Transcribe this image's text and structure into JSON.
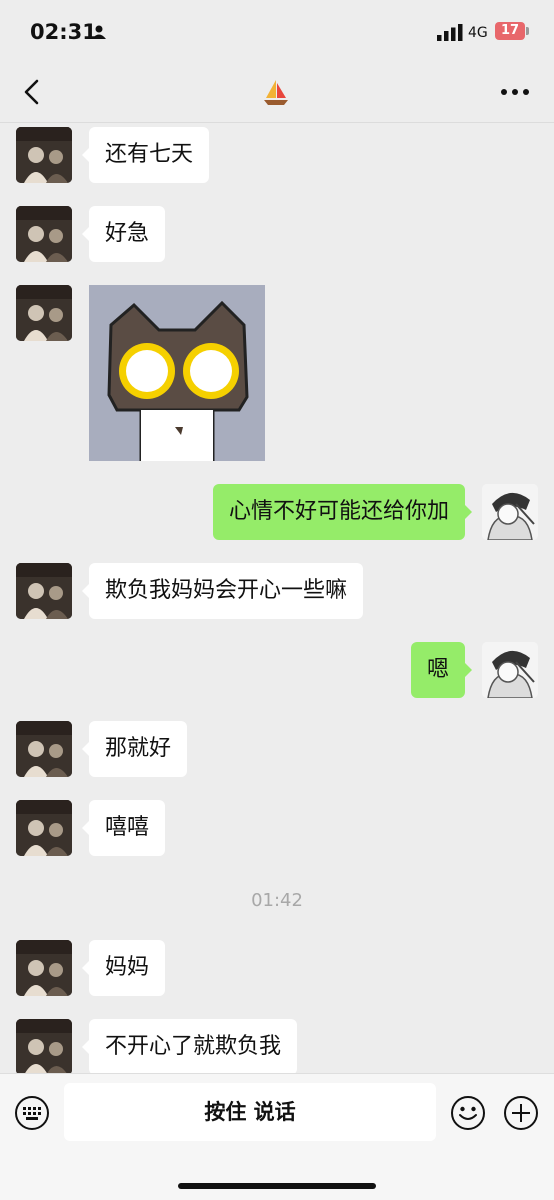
{
  "status": {
    "time": "02:31",
    "network": "4G",
    "battery": "17"
  },
  "nav": {
    "back_icon": "chevron-left-icon",
    "title_icon": "sailboat-icon",
    "more_icon": "more-dots-icon"
  },
  "messages": [
    {
      "side": "in",
      "text": "还有七天"
    },
    {
      "side": "in",
      "text": "好急"
    },
    {
      "side": "in",
      "type": "sticker",
      "sticker": "glowing-eyes-cat-sticker"
    },
    {
      "side": "out",
      "text": "心情不好可能还给你加"
    },
    {
      "side": "in",
      "text": "欺负我妈妈会开心一些嘛"
    },
    {
      "side": "out",
      "text": "嗯"
    },
    {
      "side": "in",
      "text": "那就好"
    },
    {
      "side": "in",
      "text": "嘻嘻"
    },
    {
      "type": "time",
      "text": "01:42"
    },
    {
      "side": "in",
      "text": "妈妈"
    },
    {
      "side": "in",
      "text": "不开心了就欺负我"
    }
  ],
  "input_bar": {
    "voice_label": "按住 说话",
    "left_icon": "keyboard-icon",
    "emoji_icon": "emoji-icon",
    "plus_icon": "plus-icon"
  },
  "colors": {
    "bubble_out": "#95ec69",
    "bubble_in": "#ffffff",
    "background": "#ededed"
  }
}
